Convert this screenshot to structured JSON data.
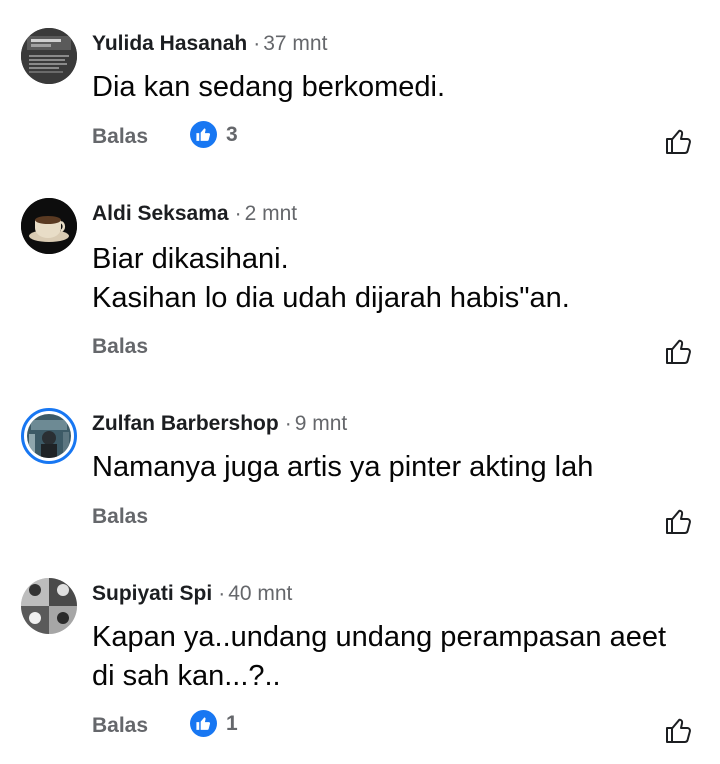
{
  "comments": [
    {
      "author": "Yulida Hasanah",
      "time": "37 mnt",
      "lines": [
        "Dia kan sedang berkomedi."
      ],
      "reply_label": "Balas",
      "reaction_count": "3",
      "avatar": "poster-avatar"
    },
    {
      "author": "Aldi Seksama",
      "time": "2 mnt",
      "lines": [
        "Biar dikasihani.",
        "Kasihan lo dia udah dijarah habis\"an."
      ],
      "reply_label": "Balas",
      "reaction_count": null,
      "avatar": "coffee-cup-avatar"
    },
    {
      "author": "Zulfan Barbershop",
      "time": "9 mnt",
      "lines": [
        "Namanya juga artis ya pinter akting lah"
      ],
      "reply_label": "Balas",
      "reaction_count": null,
      "avatar": "photo-avatar"
    },
    {
      "author": "Supiyati Spi",
      "time": "40 mnt",
      "lines": [
        "Kapan ya..undang undang perampasan aeet",
        "di sah kan...?.."
      ],
      "reply_label": "Balas",
      "reaction_count": "1",
      "avatar": "collage-avatar"
    }
  ],
  "colors": {
    "accent": "#1877f2",
    "secondary_text": "#65676b",
    "primary_text": "#050505"
  },
  "icons": {
    "reaction": "thumbs-up-filled-icon",
    "like_button": "thumbs-up-outline-icon"
  }
}
